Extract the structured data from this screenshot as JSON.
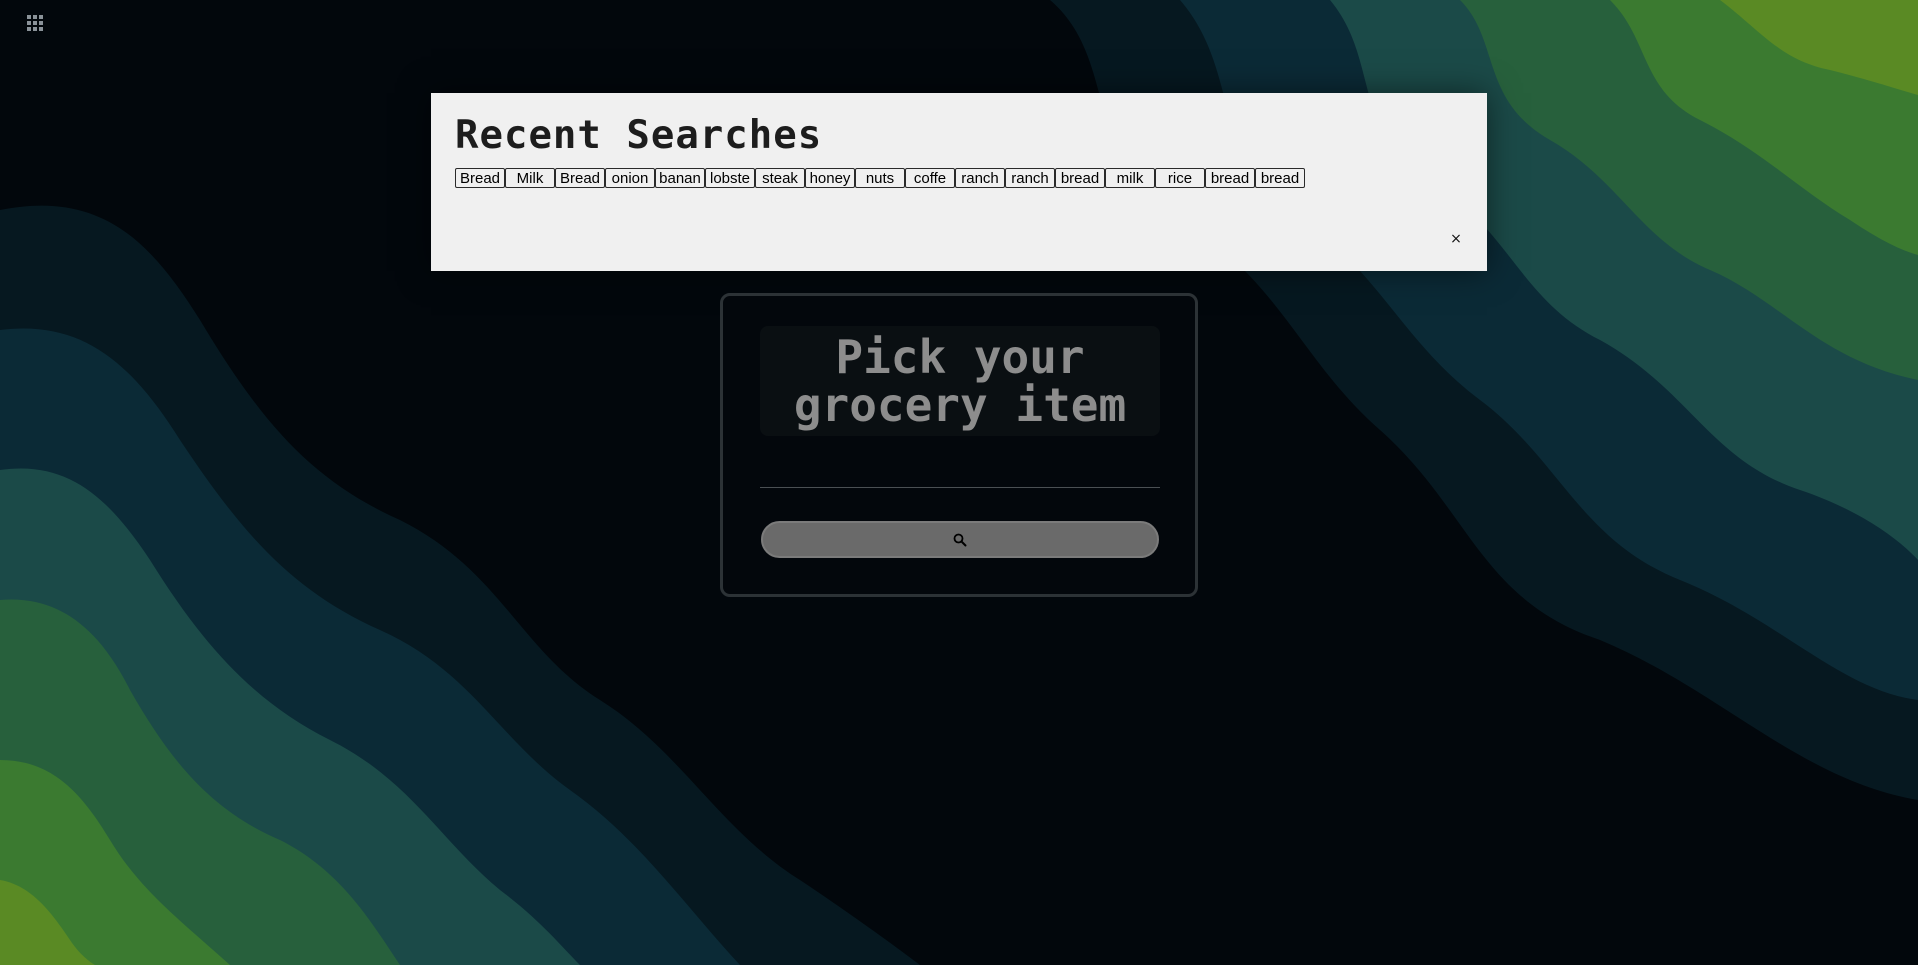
{
  "apps_icon": "apps-grid-icon",
  "recent": {
    "title": "Recent Searches",
    "chips": [
      "Bread",
      "Milk",
      "Bread",
      "onion",
      "banan",
      "lobste",
      "steak",
      "honey",
      "nuts",
      "coffe",
      "ranch",
      "ranch",
      "bread",
      "milk",
      "rice",
      "bread",
      "bread"
    ],
    "close_label": "×"
  },
  "search": {
    "heading_line1": "Pick your",
    "heading_line2": "grocery item",
    "input_value": "",
    "button_icon": "search-icon"
  },
  "colors": {
    "panel_bg": "#f0f0f0",
    "card_border": "#2c3236",
    "heading_text": "#8d8d8d",
    "search_button": "#6a6a6a"
  }
}
